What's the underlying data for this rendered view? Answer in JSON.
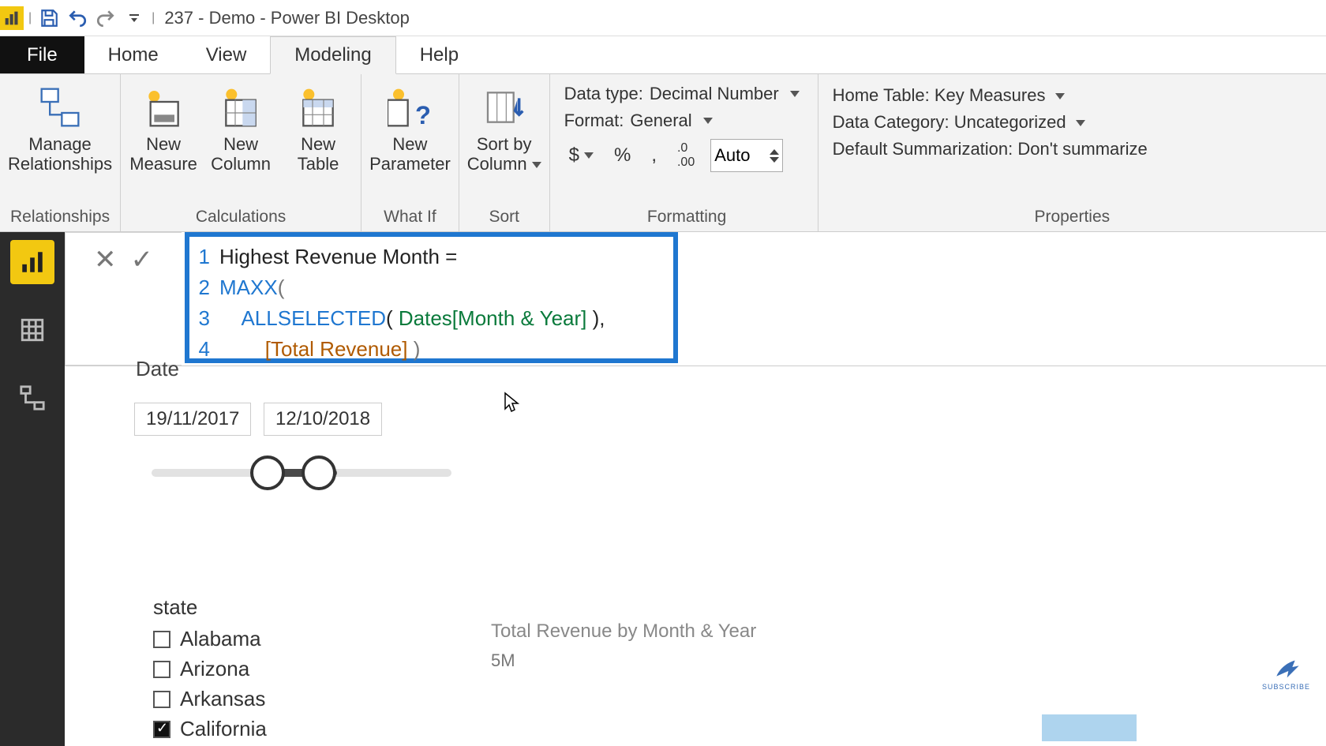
{
  "title": "237 - Demo - Power BI Desktop",
  "tabs": {
    "file": "File",
    "home": "Home",
    "view": "View",
    "modeling": "Modeling",
    "help": "Help"
  },
  "ribbon": {
    "relationships": {
      "btn": "Manage\nRelationships",
      "label": "Relationships"
    },
    "calculations": {
      "measure": "New\nMeasure",
      "column": "New\nColumn",
      "table": "New\nTable",
      "label": "Calculations"
    },
    "whatif": {
      "btn": "New\nParameter",
      "label": "What If"
    },
    "sort": {
      "btn": "Sort by\nColumn",
      "label": "Sort"
    },
    "formatting": {
      "datatype_lbl": "Data type:",
      "datatype_val": "Decimal Number",
      "format_lbl": "Format:",
      "format_val": "General",
      "decimals": "Auto",
      "label": "Formatting"
    },
    "properties": {
      "home_lbl": "Home Table:",
      "home_val": "Key Measures",
      "cat_lbl": "Data Category:",
      "cat_val": "Uncategorized",
      "sum_lbl": "Default Summarization:",
      "sum_val": "Don't summarize",
      "label": "Properties"
    }
  },
  "formula": {
    "lines": [
      "1",
      "2",
      "3",
      "4"
    ],
    "l1a": "Highest Revenue Month =",
    "l2a": "MAXX",
    "l2b": "(",
    "l3a": "ALLSELECTED",
    "l3b": "( ",
    "l3c": "Dates[Month & Year]",
    "l3d": " ),",
    "l4a": "[Total Revenue]",
    "l4b": " )"
  },
  "date_slicer": {
    "label": "Date",
    "start": "19/11/2017",
    "end": "12/10/2018"
  },
  "state_slicer": {
    "label": "state",
    "items": [
      {
        "name": "Alabama",
        "checked": false
      },
      {
        "name": "Arizona",
        "checked": false
      },
      {
        "name": "Arkansas",
        "checked": false
      },
      {
        "name": "California",
        "checked": true
      }
    ]
  },
  "chart": {
    "title": "Total Revenue by Month & Year",
    "ytick": "5M"
  },
  "badge": "SUBSCRIBE"
}
